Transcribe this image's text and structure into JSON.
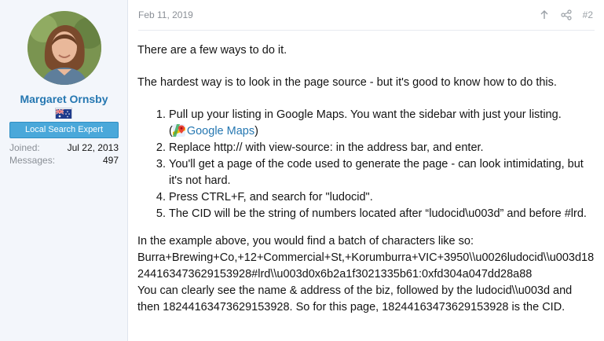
{
  "user": {
    "name": "Margaret Ornsby",
    "badge": "Local Search Expert",
    "stats": [
      {
        "key": "Joined:",
        "value": "Jul 22, 2013"
      },
      {
        "key": "Messages:",
        "value": "497"
      }
    ],
    "flag_icon": "australia-flag-icon"
  },
  "post": {
    "date": "Feb 11, 2019",
    "number": "#2",
    "p1": "There are a few ways to do it.",
    "p2": "The hardest way is to look in the page source - but it's good to know how to do this.",
    "steps": [
      "Pull up your listing in Google Maps. You want the sidebar with just your listing.",
      "Replace http:// with view-source: in the address bar, and enter.",
      "You'll get a page of the code used to generate the page - can look intimidating, but it's not hard.",
      "Press CTRL+F, and search for \"ludocid\".",
      "The CID will be the string of numbers located after “ludocid\\u003d” and before #lrd."
    ],
    "maps_link_open": "(",
    "maps_link_text": "Google Maps",
    "maps_link_close": ")",
    "p3_line1": "In the example above, you would find a batch of characters like so:",
    "p3_line2": "Burra+Brewing+Co,+12+Commercial+St,+Korumburra+VIC+3950\\\\u0026ludocid\\\\u003d18244163473629153928#lrd\\\\u003d0x6b2a1f3021335b61:0xfd304a047dd28a88",
    "p3_line3": "You can clearly see the name & address of the biz, followed by the ludocid\\\\u003d and then 18244163473629153928. So for this page, 18244163473629153928 is the CID."
  },
  "colors": {
    "accent": "#2577b1",
    "badge_bg": "#4aa8da",
    "sidebar_bg": "#f3f6fb"
  }
}
